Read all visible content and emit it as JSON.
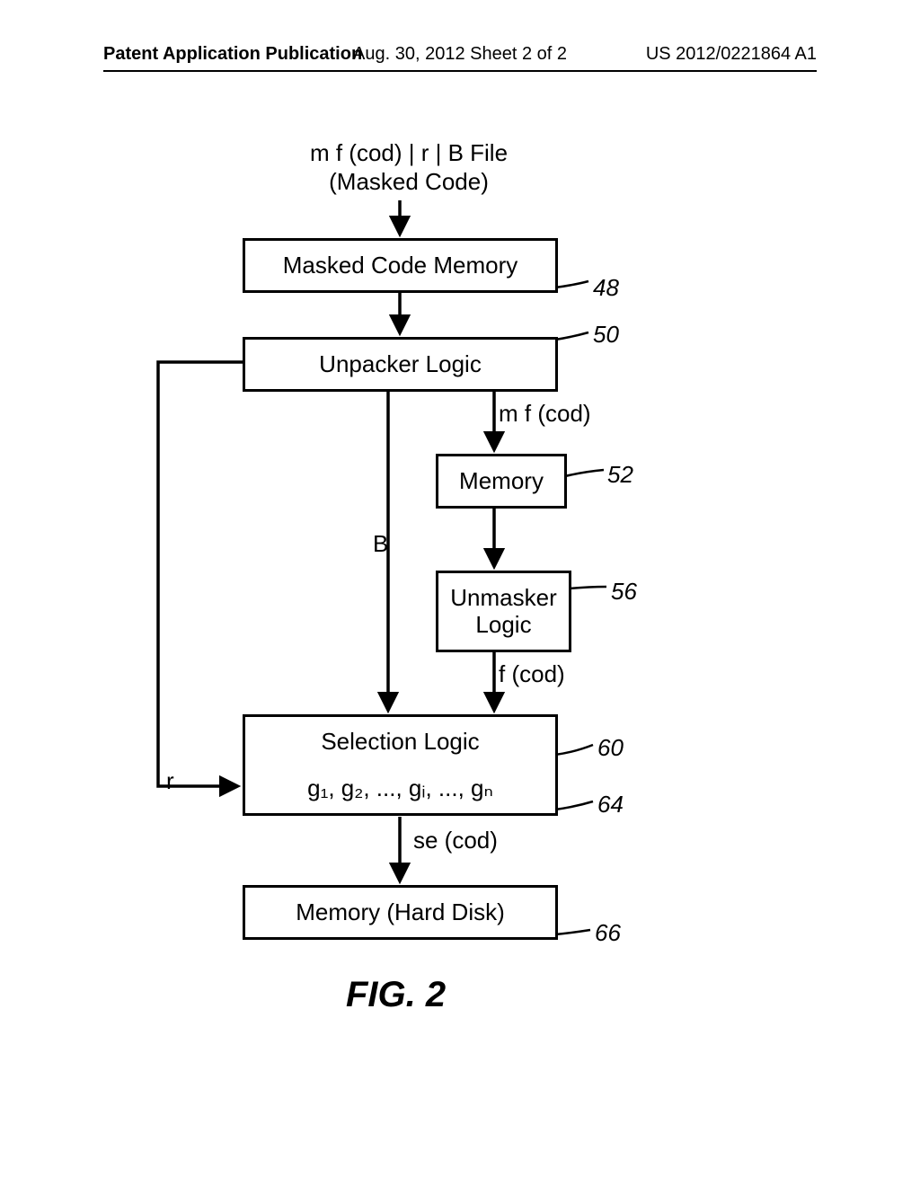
{
  "header": {
    "left": "Patent Application Publication",
    "center": "Aug. 30, 2012  Sheet 2 of 2",
    "right": "US 2012/0221864 A1"
  },
  "diagram": {
    "input_line1": "m f (cod) | r | B File",
    "input_line2": "(Masked Code)",
    "box_masked_mem": "Masked Code Memory",
    "box_unpacker": "Unpacker Logic",
    "label_mfcod": "m f (cod)",
    "box_memory": "Memory",
    "label_B": "B",
    "box_unmasker_line1": "Unmasker",
    "box_unmasker_line2": "Logic",
    "label_fcod": "f (cod)",
    "box_selection": "Selection Logic",
    "box_g_fns": "g₁, g₂, ..., gᵢ, ..., gₙ",
    "label_r": "r",
    "label_secod": "se (cod)",
    "box_harddisk": "Memory (Hard Disk)",
    "ref_48": "48",
    "ref_50": "50",
    "ref_52": "52",
    "ref_56": "56",
    "ref_60": "60",
    "ref_64": "64",
    "ref_66": "66"
  },
  "figure_caption": "FIG. 2"
}
